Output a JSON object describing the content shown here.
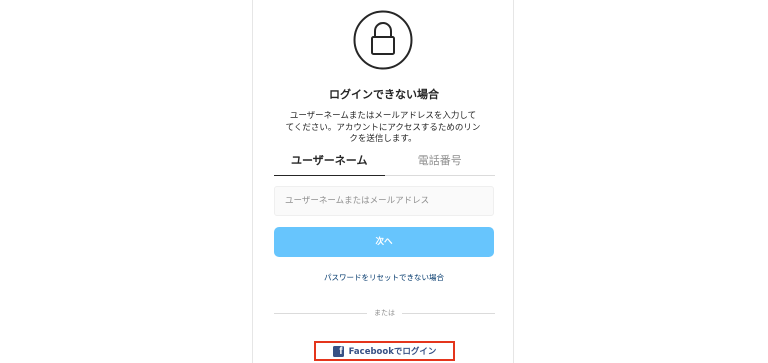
{
  "header": {
    "title": "ログインできない場合",
    "description": "ユーザーネームまたはメールアドレスを入力して\nてください。アカウントにアクセスするためのリンクを送信します。"
  },
  "tabs": [
    {
      "label": "ユーザーネーム",
      "active": true
    },
    {
      "label": "電話番号",
      "active": false
    }
  ],
  "form": {
    "identifier_placeholder": "ユーザーネームまたはメールアドレス",
    "identifier_value": "",
    "next_label": "次へ"
  },
  "links": {
    "reset_password": "パスワードをリセットできない場合"
  },
  "divider": {
    "or_label": "または"
  },
  "facebook": {
    "icon_glyph": "f",
    "label": "Facebookでログイン"
  },
  "colors": {
    "accent_blue": "#67c5fd",
    "facebook_blue": "#385185",
    "link_blue": "#00376b",
    "highlight_red": "#e4351c"
  },
  "icons": {
    "lock": "lock-icon",
    "facebook": "facebook-icon"
  }
}
